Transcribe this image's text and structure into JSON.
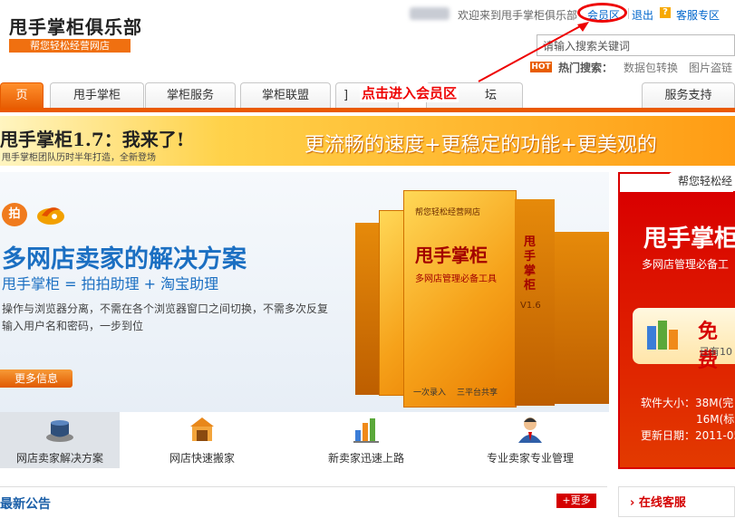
{
  "header": {
    "logo_title": "甩手掌柜俱乐部",
    "logo_slogan": "帮您轻松经营网店",
    "welcome": "欢迎来到甩手掌柜俱乐部",
    "member_link": "会员区",
    "logout": "退出",
    "cs_icon_text": "?",
    "cs_link": "客服专区",
    "search_placeholder": "请输入搜索关键词",
    "hot_badge": "HOT",
    "hot_label": "热门搜索：",
    "hot_words": [
      "数据包转换",
      "图片盗链"
    ]
  },
  "nav": {
    "tabs": [
      "页",
      "甩手掌柜",
      "掌柜服务",
      "掌柜联盟",
      "]",
      "坛",
      "服务支持"
    ],
    "annotation": "点击进入会员区"
  },
  "banner": {
    "title": "甩手掌柜1.7：我来了!",
    "subtitle": "甩手掌柜团队历时半年打造，全新登场",
    "slogan": "更流畅的速度+更稳定的功能+更美观的"
  },
  "hero": {
    "icon1_text": "拍",
    "headline": "多网店卖家的解决方案",
    "subheadline": "甩手掌柜 = 拍拍助理 + 淘宝助理",
    "desc_line1": "操作与浏览器分离，不需在各个浏览器窗口之间切换，不需多次反复",
    "desc_line2": "输入用户名和密码，一步到位",
    "more_button": "更多信息",
    "box_title": "甩手掌柜",
    "box_version": "V1.6",
    "box_sub": "多网店管理必备工具",
    "box_label_1": "一次录入",
    "box_label_2": "三平台共享",
    "box_top": "帮您轻松经营网店"
  },
  "features": [
    {
      "label": "网店卖家解决方案"
    },
    {
      "label": "网店快速搬家"
    },
    {
      "label": "新卖家迅速上路"
    },
    {
      "label": "专业卖家专业管理"
    }
  ],
  "news": {
    "title": "最新公告",
    "more": "更多"
  },
  "promo": {
    "tab": "帮您轻松经",
    "title": "甩手掌柜",
    "subtitle": "多网店管理必备工",
    "free": "免费",
    "free_sub": "已有10",
    "info_size": "软件大小：38M(完",
    "info_size2": "16M(标",
    "info_date": "更新日期：2011-05"
  },
  "support": {
    "title": "在线客服"
  },
  "colors": {
    "accent": "#ea5a00",
    "blue": "#1b6fc2",
    "promo_red": "#d90000"
  }
}
